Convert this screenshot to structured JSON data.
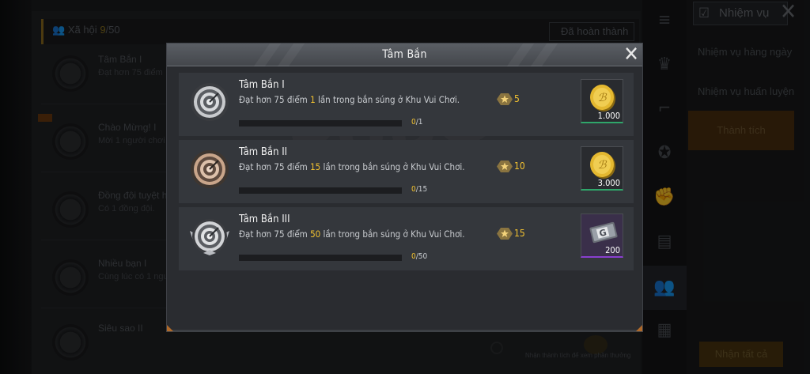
{
  "background": {
    "social_label": "Xã hội",
    "social_count_current": "9",
    "social_count_total": "/50",
    "done_tab": "Đã hoàn thành",
    "rows": [
      {
        "title": "Tâm Bắn I",
        "subtitle": "Đạt hơn 75 điểm"
      },
      {
        "title": "Chào Mừng! I",
        "subtitle": "Mời 1 người chơi t"
      },
      {
        "title": "Đồng đội tuyệt h",
        "subtitle": "Có 1 đồng đội."
      },
      {
        "title": "Nhiều bạn I",
        "subtitle": "Cùng lúc có 1 người"
      },
      {
        "title": "Siêu sao II",
        "subtitle": ""
      }
    ],
    "footnote": "Nhận thành tích để xem phần thưởng",
    "right_panel": {
      "title": "Nhiệm vụ",
      "items": [
        "Nhiệm vụ hàng ngày",
        "Nhiệm vụ huấn luyện"
      ],
      "active_item": "Thành tích",
      "claim_all": "Nhận tất cả"
    }
  },
  "modal": {
    "title": "Tâm Bắn",
    "tasks": [
      {
        "title": "Tâm Bắn I",
        "desc_pre": "Đạt hơn 75 điểm ",
        "desc_num": "1",
        "desc_post": " lần trong bắn súng ở Khu Vui Chơi.",
        "progress_current": "0",
        "progress_total": "/1",
        "progress_fraction": 0,
        "points": "5",
        "reward_qty": "1.000",
        "reward_type": "bp-coin",
        "badge_tier": "silver"
      },
      {
        "title": "Tâm Bắn II",
        "desc_pre": "Đạt hơn 75 điểm ",
        "desc_num": "15",
        "desc_post": " lần trong bắn súng ở Khu Vui Chơi.",
        "progress_current": "0",
        "progress_total": "/15",
        "progress_fraction": 0,
        "points": "10",
        "reward_qty": "3.000",
        "reward_type": "bp-coin",
        "badge_tier": "bronze"
      },
      {
        "title": "Tâm Bắn III",
        "desc_pre": "Đạt hơn 75 điểm ",
        "desc_num": "50",
        "desc_post": " lần trong bắn súng ở Khu Vui Chơi.",
        "progress_current": "0",
        "progress_total": "/50",
        "progress_fraction": 0,
        "points": "15",
        "reward_qty": "200",
        "reward_type": "ticket",
        "badge_tier": "silver-wing"
      }
    ]
  },
  "colors": {
    "accent_gold": "#f3c230",
    "header_gray": "#4e5257",
    "row_bg": "#34373c"
  }
}
